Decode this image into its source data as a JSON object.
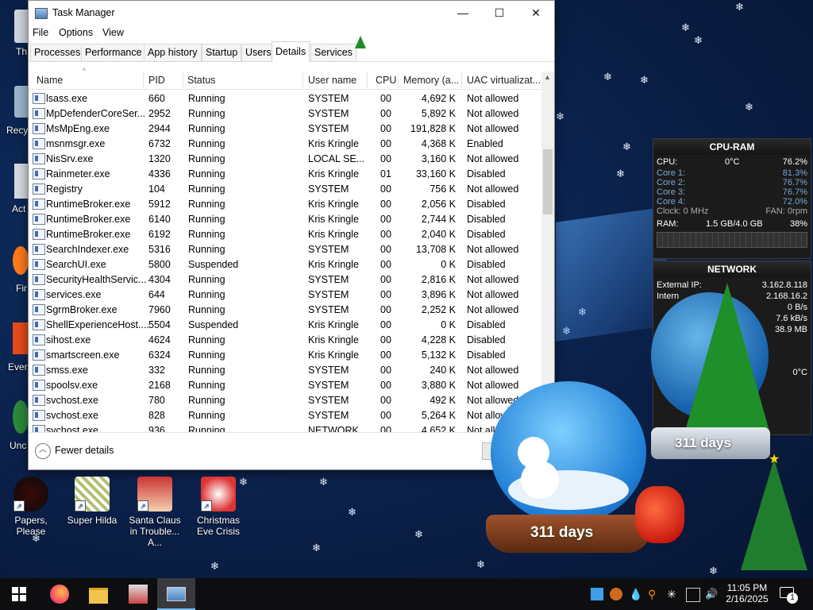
{
  "window": {
    "title": "Task Manager",
    "minimize": "—",
    "maximize": "☐",
    "close": "✕"
  },
  "menu": [
    "File",
    "Options",
    "View"
  ],
  "tabs": [
    "Processes",
    "Performance",
    "App history",
    "Startup",
    "Users",
    "Details",
    "Services"
  ],
  "active_tab": "Details",
  "columns": [
    "Name",
    "PID",
    "Status",
    "User name",
    "CPU",
    "Memory (a...",
    "UAC virtualizat..."
  ],
  "rows": [
    {
      "name": "lsass.exe",
      "pid": "660",
      "status": "Running",
      "user": "SYSTEM",
      "cpu": "00",
      "mem": "4,692 K",
      "uac": "Not allowed"
    },
    {
      "name": "MpDefenderCoreSer...",
      "pid": "2952",
      "status": "Running",
      "user": "SYSTEM",
      "cpu": "00",
      "mem": "5,892 K",
      "uac": "Not allowed"
    },
    {
      "name": "MsMpEng.exe",
      "pid": "2944",
      "status": "Running",
      "user": "SYSTEM",
      "cpu": "00",
      "mem": "191,828 K",
      "uac": "Not allowed"
    },
    {
      "name": "msnmsgr.exe",
      "pid": "6732",
      "status": "Running",
      "user": "Kris Kringle",
      "cpu": "00",
      "mem": "4,368 K",
      "uac": "Enabled"
    },
    {
      "name": "NisSrv.exe",
      "pid": "1320",
      "status": "Running",
      "user": "LOCAL SE...",
      "cpu": "00",
      "mem": "3,160 K",
      "uac": "Not allowed"
    },
    {
      "name": "Rainmeter.exe",
      "pid": "4336",
      "status": "Running",
      "user": "Kris Kringle",
      "cpu": "01",
      "mem": "33,160 K",
      "uac": "Disabled"
    },
    {
      "name": "Registry",
      "pid": "104",
      "status": "Running",
      "user": "SYSTEM",
      "cpu": "00",
      "mem": "756 K",
      "uac": "Not allowed"
    },
    {
      "name": "RuntimeBroker.exe",
      "pid": "5912",
      "status": "Running",
      "user": "Kris Kringle",
      "cpu": "00",
      "mem": "2,056 K",
      "uac": "Disabled"
    },
    {
      "name": "RuntimeBroker.exe",
      "pid": "6140",
      "status": "Running",
      "user": "Kris Kringle",
      "cpu": "00",
      "mem": "2,744 K",
      "uac": "Disabled"
    },
    {
      "name": "RuntimeBroker.exe",
      "pid": "6192",
      "status": "Running",
      "user": "Kris Kringle",
      "cpu": "00",
      "mem": "2,040 K",
      "uac": "Disabled"
    },
    {
      "name": "SearchIndexer.exe",
      "pid": "5316",
      "status": "Running",
      "user": "SYSTEM",
      "cpu": "00",
      "mem": "13,708 K",
      "uac": "Not allowed"
    },
    {
      "name": "SearchUI.exe",
      "pid": "5800",
      "status": "Suspended",
      "user": "Kris Kringle",
      "cpu": "00",
      "mem": "0 K",
      "uac": "Disabled"
    },
    {
      "name": "SecurityHealthServic...",
      "pid": "4304",
      "status": "Running",
      "user": "SYSTEM",
      "cpu": "00",
      "mem": "2,816 K",
      "uac": "Not allowed"
    },
    {
      "name": "services.exe",
      "pid": "644",
      "status": "Running",
      "user": "SYSTEM",
      "cpu": "00",
      "mem": "3,896 K",
      "uac": "Not allowed"
    },
    {
      "name": "SgrmBroker.exe",
      "pid": "7960",
      "status": "Running",
      "user": "SYSTEM",
      "cpu": "00",
      "mem": "2,252 K",
      "uac": "Not allowed"
    },
    {
      "name": "ShellExperienceHost....",
      "pid": "5504",
      "status": "Suspended",
      "user": "Kris Kringle",
      "cpu": "00",
      "mem": "0 K",
      "uac": "Disabled"
    },
    {
      "name": "sihost.exe",
      "pid": "4624",
      "status": "Running",
      "user": "Kris Kringle",
      "cpu": "00",
      "mem": "4,228 K",
      "uac": "Disabled"
    },
    {
      "name": "smartscreen.exe",
      "pid": "6324",
      "status": "Running",
      "user": "Kris Kringle",
      "cpu": "00",
      "mem": "5,132 K",
      "uac": "Disabled"
    },
    {
      "name": "smss.exe",
      "pid": "332",
      "status": "Running",
      "user": "SYSTEM",
      "cpu": "00",
      "mem": "240 K",
      "uac": "Not allowed"
    },
    {
      "name": "spoolsv.exe",
      "pid": "2168",
      "status": "Running",
      "user": "SYSTEM",
      "cpu": "00",
      "mem": "3,880 K",
      "uac": "Not allowed"
    },
    {
      "name": "svchost.exe",
      "pid": "780",
      "status": "Running",
      "user": "SYSTEM",
      "cpu": "00",
      "mem": "492 K",
      "uac": "Not allowed"
    },
    {
      "name": "svchost.exe",
      "pid": "828",
      "status": "Running",
      "user": "SYSTEM",
      "cpu": "00",
      "mem": "5,264 K",
      "uac": "Not allowed"
    },
    {
      "name": "svchost.exe",
      "pid": "936",
      "status": "Running",
      "user": "NETWORK...",
      "cpu": "00",
      "mem": "4,652 K",
      "uac": "Not allowed"
    }
  ],
  "footer": {
    "fewer_details": "Fewer details"
  },
  "gadget_cpu": {
    "title": "CPU-RAM",
    "cpu_label": "CPU:",
    "temp": "0°C",
    "cpu_pct": "76.2%",
    "cores": [
      {
        "label": "Core 1:",
        "value": "81.3%"
      },
      {
        "label": "Core 2:",
        "value": "76.7%"
      },
      {
        "label": "Core 3:",
        "value": "76.7%"
      },
      {
        "label": "Core 4:",
        "value": "72.0%"
      }
    ],
    "clock": "Clock: 0 MHz",
    "fan": "FAN: 0rpm",
    "ram_label": "RAM:",
    "ram_value": "1.5 GB/4.0 GB",
    "ram_pct": "38%"
  },
  "gadget_net": {
    "title": "NETWORK",
    "external_label": "External IP:",
    "external_value": "3.162.8.118",
    "internal_label": "Intern",
    "internal_value": "2.168.16.2",
    "v1": "0 B/s",
    "v2": "7.6 kB/s",
    "v3": "38.9 MB",
    "v4": "0°C"
  },
  "globe_label": "311 days",
  "desktop_icons": [
    {
      "label": "Papers, Please"
    },
    {
      "label": "Super Hilda"
    },
    {
      "label": "Santa Claus in Trouble... A..."
    },
    {
      "label": "Christmas Eve Crisis"
    }
  ],
  "edge_labels": [
    "Th",
    "Recy",
    "Act",
    "Fir",
    "Ever",
    "Unc"
  ],
  "clock": {
    "time": "11:05 PM",
    "date": "2/16/2025"
  },
  "notification_count": "1"
}
